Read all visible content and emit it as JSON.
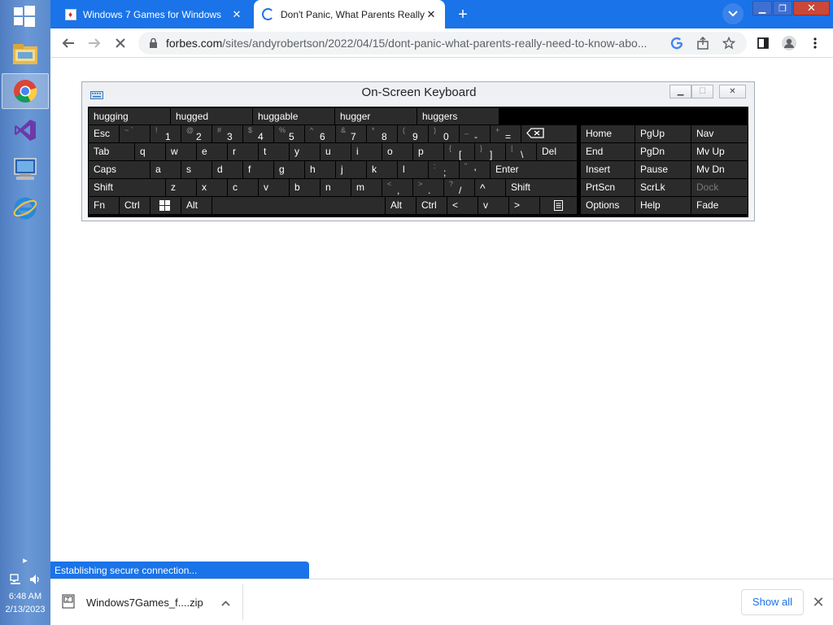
{
  "taskbar": {
    "apps": [
      {
        "name": "file-explorer",
        "active": false
      },
      {
        "name": "chrome",
        "active": true
      },
      {
        "name": "visual-studio",
        "active": false
      },
      {
        "name": "computer-screen",
        "active": false
      },
      {
        "name": "internet-explorer",
        "active": false
      }
    ],
    "clock_time": "6:48 AM",
    "clock_date": "2/13/2023"
  },
  "browser": {
    "tabs": [
      {
        "title": "Windows 7 Games for Windows",
        "active": false
      },
      {
        "title": "Don't Panic, What Parents Really",
        "active": true
      }
    ],
    "url_host": "forbes.com",
    "url_path": "/sites/andyrobertson/2022/04/15/dont-panic-what-parents-really-need-to-know-abo...",
    "status_text": "Establishing secure connection..."
  },
  "osk": {
    "title": "On-Screen Keyboard",
    "predictions": [
      "hugging",
      "hugged",
      "huggable",
      "hugger",
      "huggers"
    ],
    "rows": {
      "r1": {
        "esc": "Esc",
        "backtick": {
          "shift": "~",
          "main": "`"
        },
        "nums": [
          {
            "s": "!",
            "m": "1"
          },
          {
            "s": "@",
            "m": "2"
          },
          {
            "s": "#",
            "m": "3"
          },
          {
            "s": "$",
            "m": "4"
          },
          {
            "s": "%",
            "m": "5"
          },
          {
            "s": "^",
            "m": "6"
          },
          {
            "s": "&",
            "m": "7"
          },
          {
            "s": "*",
            "m": "8"
          },
          {
            "s": "(",
            "m": "9"
          },
          {
            "s": ")",
            "m": "0"
          },
          {
            "s": "_",
            "m": "-"
          },
          {
            "s": "+",
            "m": "="
          }
        ]
      },
      "r2": {
        "tab": "Tab",
        "letters": [
          "q",
          "w",
          "e",
          "r",
          "t",
          "y",
          "u",
          "i",
          "o",
          "p"
        ],
        "lbracket": {
          "s": "{",
          "m": "["
        },
        "rbracket": {
          "s": "}",
          "m": "]"
        },
        "pipe": {
          "s": "|",
          "m": "\\"
        },
        "del": "Del"
      },
      "r3": {
        "caps": "Caps",
        "letters": [
          "a",
          "s",
          "d",
          "f",
          "g",
          "h",
          "j",
          "k",
          "l"
        ],
        "semicolon": {
          "s": ":",
          "m": ";"
        },
        "quote": {
          "s": "\"",
          "m": "'"
        },
        "enter": "Enter"
      },
      "r4": {
        "shift": "Shift",
        "letters": [
          "z",
          "x",
          "c",
          "v",
          "b",
          "n",
          "m"
        ],
        "comma": {
          "s": "<",
          "m": ","
        },
        "period": {
          "s": ">",
          "m": "."
        },
        "slash": {
          "s": "?",
          "m": "/"
        },
        "up": "^",
        "rshift": "Shift"
      },
      "r5": {
        "fn": "Fn",
        "ctrl": "Ctrl",
        "alt": "Alt",
        "ralt": "Alt",
        "rctrl": "Ctrl",
        "left": "<",
        "down": "v",
        "right": ">"
      }
    },
    "nav": [
      [
        "Home",
        "PgUp",
        "Nav"
      ],
      [
        "End",
        "PgDn",
        "Mv Up"
      ],
      [
        "Insert",
        "Pause",
        "Mv Dn"
      ],
      [
        "PrtScn",
        "ScrLk",
        "Dock"
      ],
      [
        "Options",
        "Help",
        "Fade"
      ]
    ]
  },
  "downloads": {
    "file_name": "Windows7Games_f....zip",
    "show_all_label": "Show all"
  }
}
